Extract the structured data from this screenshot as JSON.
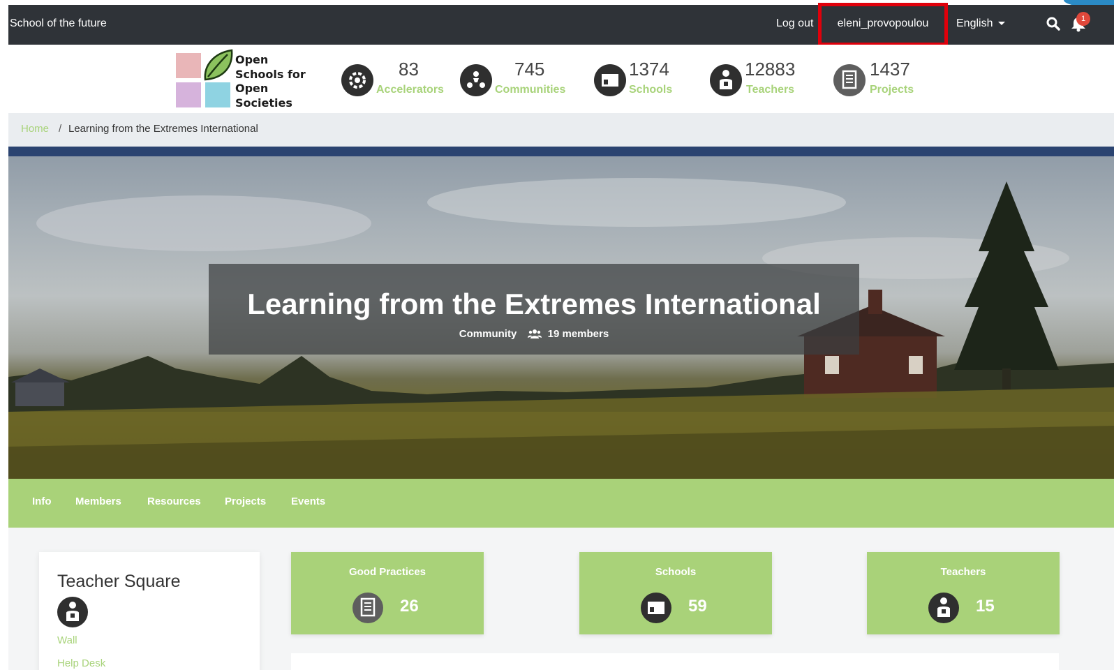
{
  "topbar": {
    "brand": "School of the future",
    "logout": "Log out",
    "username": "eleni_provopoulou",
    "language": "English",
    "notification_count": "1",
    "search_icon": "search-icon",
    "bell_icon": "bell-icon"
  },
  "logo": {
    "lines": [
      "Open",
      "Schools for",
      "Open",
      "Societies"
    ],
    "colors": [
      "#e9b6b8",
      "#8cc25e",
      "#d6b3dc",
      "#8fd3e2"
    ]
  },
  "stats": [
    {
      "value": "83",
      "label": "Accelerators",
      "icon": "accelerators-icon"
    },
    {
      "value": "745",
      "label": "Communities",
      "icon": "communities-icon"
    },
    {
      "value": "1374",
      "label": "Schools",
      "icon": "schools-icon"
    },
    {
      "value": "12883",
      "label": "Teachers",
      "icon": "teachers-icon"
    },
    {
      "value": "1437",
      "label": "Projects",
      "icon": "projects-icon"
    }
  ],
  "breadcrumb": {
    "home": "Home",
    "separator": "/",
    "current": "Learning from the Extremes International"
  },
  "hero": {
    "title": "Learning from the Extremes International",
    "type": "Community",
    "members": "19 members"
  },
  "tabs": [
    "Info",
    "Members",
    "Resources",
    "Projects",
    "Events"
  ],
  "sidebar": {
    "title": "Teacher Square",
    "links": [
      "Wall",
      "Help Desk"
    ]
  },
  "cards": [
    {
      "title": "Good Practices",
      "value": "26",
      "icon": "projects-icon"
    },
    {
      "title": "Schools",
      "value": "59",
      "icon": "schools-icon"
    },
    {
      "title": "Teachers",
      "value": "15",
      "icon": "teachers-icon"
    }
  ],
  "colors": {
    "accent_green": "#a9d279",
    "topbar": "#2f3338",
    "highlight_red": "#e0000b"
  }
}
